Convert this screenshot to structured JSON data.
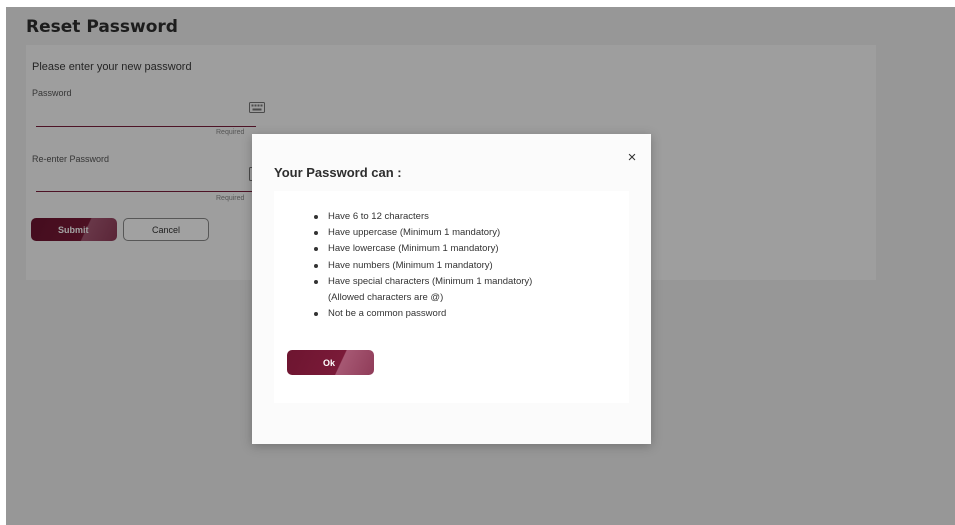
{
  "page": {
    "title": "Reset Password"
  },
  "form": {
    "instruction": "Please enter your new password",
    "password_label": "Password",
    "password_required": "Required",
    "reenter_label": "Re-enter Password",
    "reenter_required": "Required",
    "submit_label": "Submit",
    "cancel_label": "Cancel"
  },
  "modal": {
    "title": "Your Password can :",
    "close_symbol": "×",
    "rules": [
      "Have 6 to 12 characters",
      "Have uppercase (Minimum 1 mandatory)",
      "Have lowercase (Minimum 1 mandatory)",
      "Have numbers (Minimum 1 mandatory)",
      "Have special characters (Minimum 1 mandatory)",
      "Not be a common password"
    ],
    "rule_note": "(Allowed characters are @)",
    "ok_label": "Ok"
  },
  "colors": {
    "accent": "#7a1a38",
    "overlay": "rgba(0,0,0,0.37)"
  },
  "icons": {
    "keyboard": "keyboard-icon",
    "close": "close-icon"
  }
}
